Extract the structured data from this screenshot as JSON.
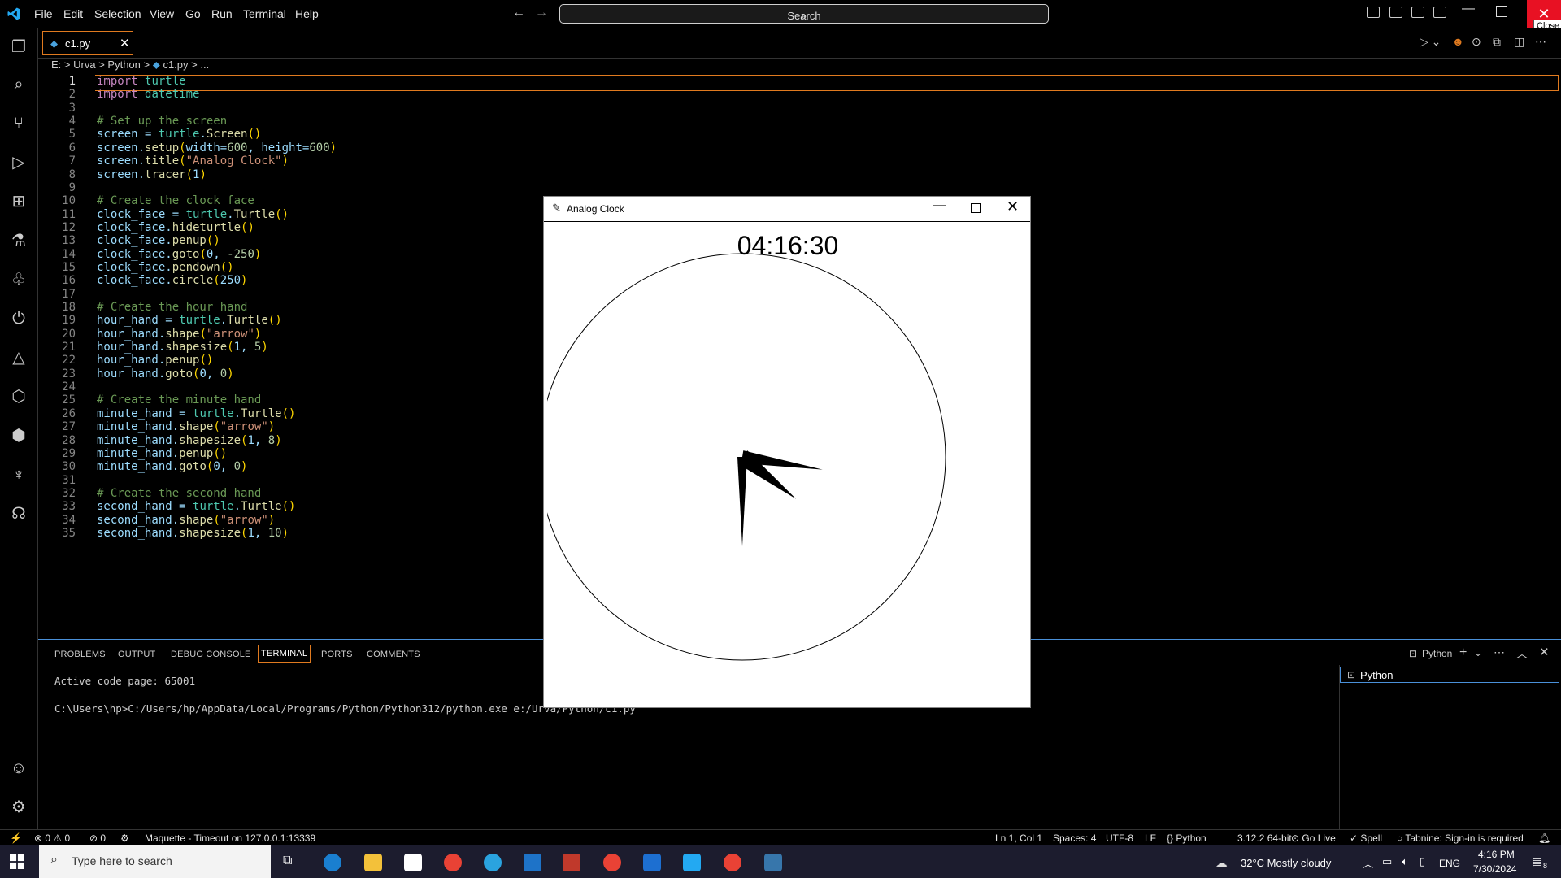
{
  "menu": [
    "File",
    "Edit",
    "Selection",
    "View",
    "Go",
    "Run",
    "Terminal",
    "Help"
  ],
  "search": {
    "label": "Search"
  },
  "window": {
    "close_tooltip": "Close"
  },
  "tab": {
    "name": "c1.py"
  },
  "breadcrumb": [
    "E:",
    "Urva",
    "Python",
    "c1.py",
    "..."
  ],
  "code": [
    "import turtle",
    "import datetime",
    "",
    "# Set up the screen",
    "screen = turtle.Screen()",
    "screen.setup(width=600, height=600)",
    "screen.title(\"Analog Clock\")",
    "screen.tracer(1)",
    "",
    "# Create the clock face",
    "clock_face = turtle.Turtle()",
    "clock_face.hideturtle()",
    "clock_face.penup()",
    "clock_face.goto(0, -250)",
    "clock_face.pendown()",
    "clock_face.circle(250)",
    "",
    "# Create the hour hand",
    "hour_hand = turtle.Turtle()",
    "hour_hand.shape(\"arrow\")",
    "hour_hand.shapesize(1, 5)",
    "hour_hand.penup()",
    "hour_hand.goto(0, 0)",
    "",
    "# Create the minute hand",
    "minute_hand = turtle.Turtle()",
    "minute_hand.shape(\"arrow\")",
    "minute_hand.shapesize(1, 8)",
    "minute_hand.penup()",
    "minute_hand.goto(0, 0)",
    "",
    "# Create the second hand",
    "second_hand = turtle.Turtle()",
    "second_hand.shape(\"arrow\")",
    "second_hand.shapesize(1, 10)"
  ],
  "panel": {
    "tabs": [
      "PROBLEMS",
      "OUTPUT",
      "DEBUG CONSOLE",
      "TERMINAL",
      "PORTS",
      "COMMENTS"
    ],
    "terminal_lines": [
      "Active code page: 65001",
      "",
      "C:\\Users\\hp>C:/Users/hp/AppData/Local/Programs/Python/Python312/python.exe e:/Urva/Python/c1.py"
    ],
    "shell_label": "Python",
    "terminal_list_item": "Python"
  },
  "statusbar": {
    "errors": "0",
    "warnings": "0",
    "ports": "0",
    "maquette": "Maquette - Timeout on 127.0.0.1:13339",
    "position": "Ln 1, Col 1",
    "spaces": "Spaces: 4",
    "encoding": "UTF-8",
    "eol": "LF",
    "language": "Python",
    "interpreter": "3.12.2 64-bit",
    "golive": "Go Live",
    "spell": "Spell",
    "tabnine": "Tabnine: Sign-in is required"
  },
  "clock_window": {
    "title": "Analog Clock",
    "time": "04:16:30",
    "hour": 4,
    "minute": 16,
    "second": 30
  },
  "taskbar": {
    "search_placeholder": "Type here to search",
    "weather": "32°C  Mostly cloudy",
    "lang": "ENG",
    "time": "4:16 PM",
    "date": "7/30/2024",
    "notif_count": "8"
  }
}
